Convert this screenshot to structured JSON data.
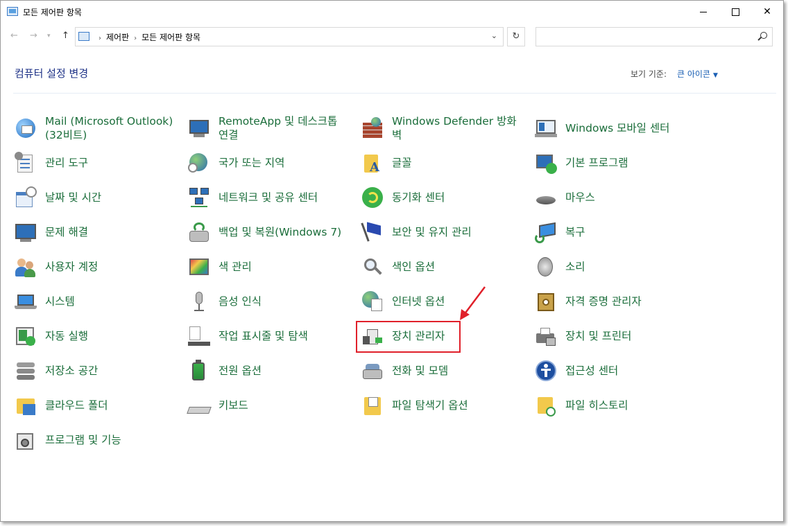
{
  "window": {
    "title": "모든 제어판 항목"
  },
  "address": {
    "crumbs": [
      "제어판",
      "모든 제어판 항목"
    ]
  },
  "search": {
    "placeholder": ""
  },
  "header": {
    "heading": "컴퓨터 설정 변경",
    "view_by_label": "보기 기준:",
    "view_by_value": "큰 아이콘"
  },
  "items": {
    "mail": "Mail (Microsoft Outlook)(32비트)",
    "admin_tools": "관리 도구",
    "date_time": "날짜 및 시간",
    "troubleshooting": "문제 해결",
    "user_accounts": "사용자 계정",
    "system": "시스템",
    "autoplay": "자동 실행",
    "storage_spaces": "저장소 공간",
    "work_folders": "클라우드 폴더",
    "programs_features": "프로그램 및 기능",
    "remoteapp": "RemoteApp 및 데스크톱 연결",
    "region": "국가 또는 지역",
    "network_sharing": "네트워크 및 공유 센터",
    "backup_restore": "백업 및 복원(Windows 7)",
    "color_management": "색 관리",
    "speech_recognition": "음성 인식",
    "taskbar_navigation": "작업 표시줄 및 탐색",
    "power_options": "전원 옵션",
    "keyboard": "키보드",
    "windows_defender_firewall": "Windows Defender 방화벽",
    "fonts": "글꼴",
    "sync_center": "동기화 센터",
    "security_maintenance": "보안 및 유지 관리",
    "indexing_options": "색인 옵션",
    "internet_options": "인터넷 옵션",
    "device_manager": "장치 관리자",
    "phone_modem": "전화 및 모뎀",
    "file_explorer_options": "파일 탐색기 옵션",
    "windows_mobility_center": "Windows 모바일 센터",
    "default_programs": "기본 프로그램",
    "mouse": "마우스",
    "recovery": "복구",
    "sound": "소리",
    "credential_manager": "자격 증명 관리자",
    "devices_printers": "장치 및 프린터",
    "ease_of_access": "접근성 센터",
    "file_history": "파일 히스토리"
  },
  "colors": {
    "link_green": "#1a6d3a",
    "heading_blue": "#1e3287",
    "annotation_red": "#e0202a"
  }
}
